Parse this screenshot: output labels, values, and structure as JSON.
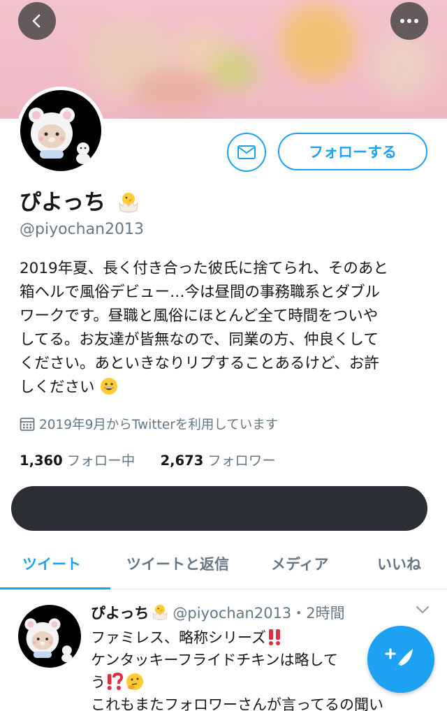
{
  "profile": {
    "display_name": "ぴよっち",
    "handle": "@piyochan2013",
    "follow_label": "フォローする",
    "bio_lines": [
      "2019年夏、長く付き合った彼氏に捨てられ、そのあと",
      "箱ヘルで風俗デビュー…今は昼間の事務職系とダブル",
      "ワークです。昼職と風俗にほとんど全て時間をついや",
      "してる。お友達が皆無なので、同業の方、仲良くして",
      "ください。あといきなりリプすることあるけど、お許",
      "しください"
    ],
    "joined": "2019年9月からTwitterを利用しています",
    "following_count": "1,360",
    "following_label": "フォロー中",
    "followers_count": "2,673",
    "followers_label": "フォロワー"
  },
  "tabs": [
    {
      "label": "ツイート",
      "active": true
    },
    {
      "label": "ツイートと返信",
      "active": false
    },
    {
      "label": "メディア",
      "active": false
    },
    {
      "label": "いいね",
      "active": false
    }
  ],
  "tweet": {
    "name": "ぴよっち",
    "handle": "@piyochan2013",
    "time": "・2時間",
    "lines": [
      "ファミレス、略称シリーズ",
      "ケンタッキーフライドチキンは略して",
      "う",
      "これもまたフォロワーさんが言ってるの聞い"
    ]
  },
  "icons": [
    "back-icon",
    "more-icon",
    "mail-icon",
    "calendar-icon",
    "hatching-chick-emoji",
    "grinning-face-emoji",
    "double-exclamation-emoji",
    "exclamation-question-emoji",
    "thinking-face-emoji",
    "chevron-down-icon",
    "compose-tweet-icon"
  ],
  "colors": {
    "accent": "#1da1f2",
    "secondary_text": "#657786",
    "banner": "#efb8c4",
    "redaction": "#2b2e33"
  }
}
